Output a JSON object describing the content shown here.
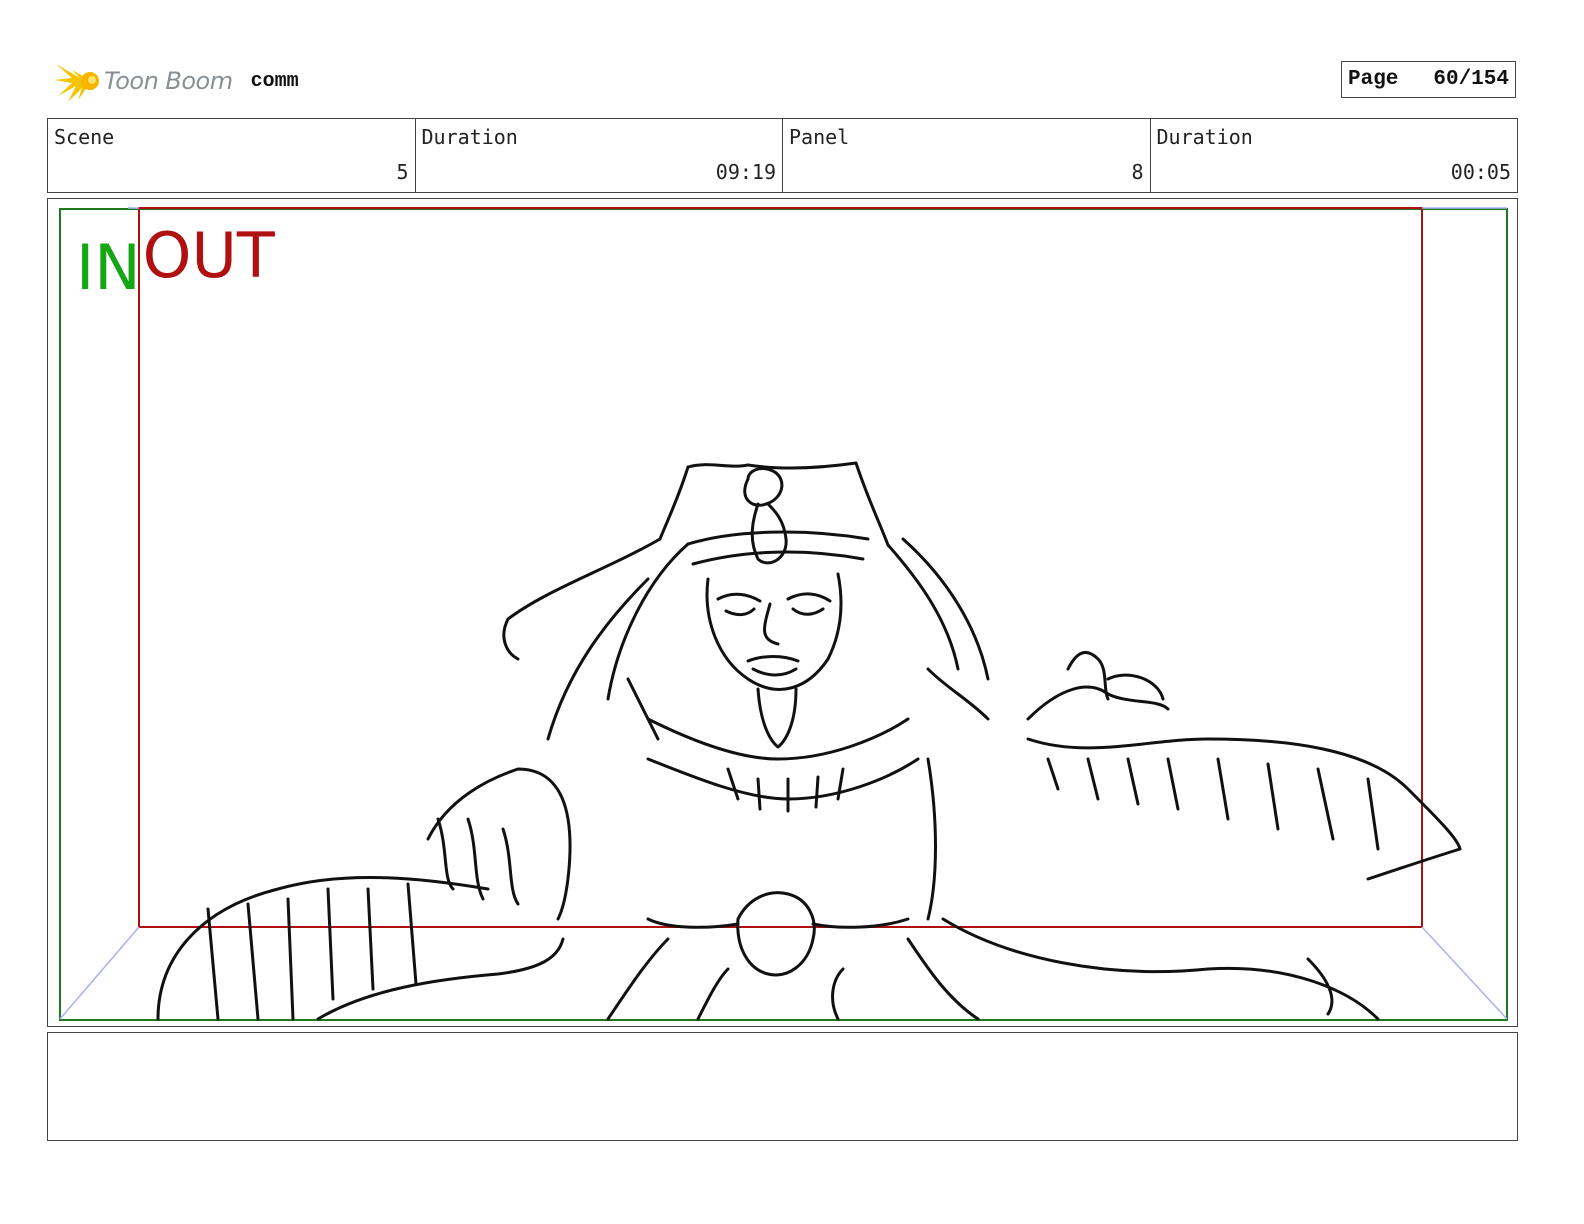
{
  "header": {
    "logo_text": "Toon Boom",
    "project_name": "comm",
    "page_label": "Page",
    "page_number": "60/154"
  },
  "info": {
    "scene_label": "Scene",
    "scene_value": "5",
    "scene_duration_label": "Duration",
    "scene_duration_value": "09:19",
    "panel_label": "Panel",
    "panel_value": "8",
    "panel_duration_label": "Duration",
    "panel_duration_value": "00:05"
  },
  "panel": {
    "in_label": "IN",
    "out_label": "OUT",
    "in_frame_color": "#1e7a1e",
    "out_frame_color": "#b01010",
    "in_text_color": "#14a614",
    "out_text_color": "#b01010",
    "sketch_description_icon": "storyboard-sketch"
  },
  "notes": {
    "text": ""
  }
}
